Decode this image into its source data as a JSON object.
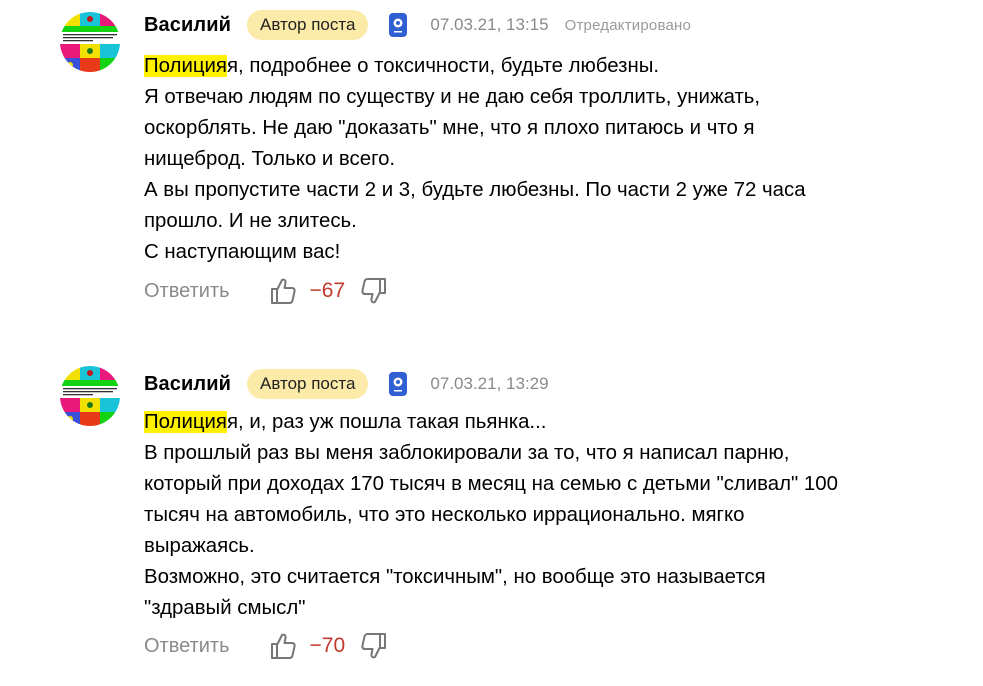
{
  "comments": [
    {
      "author": "Василий",
      "badge": "Автор поста",
      "date": "07.03.21, 13:15",
      "edited": "Отредактировано",
      "mention": "Полиция",
      "first_line_rest": "я, подробнее о токсичности, будьте любезны.",
      "lines": [
        "Я отвечаю людям по существу и не даю себя троллить, унижать,",
        "оскорблять. Не даю \"доказать\" мне, что я плохо питаюсь и что я",
        "нищеброд. Только и всего.",
        "А вы пропустите части 2 и 3, будьте любезны. По части 2 уже 72 часа",
        "прошло. И не злитесь.",
        "С наступающим вас!"
      ],
      "reply_label": "Ответить",
      "score": "−67"
    },
    {
      "author": "Василий",
      "badge": "Автор поста",
      "date": "07.03.21, 13:29",
      "mention": "Полиция",
      "first_line_rest": "я, и, раз уж пошла такая пьянка...",
      "lines": [
        "В прошлый раз вы меня заблокировали за то, что я написал парню,",
        "который при доходах 170 тысяч в месяц на семью с детьми \"сливал\" 100",
        "тысяч на автомобиль, что это несколько иррационально. мягко",
        "выражаясь.",
        "Возможно, это считается \"токсичным\", но вообще это называется",
        "\"здравый смысл\""
      ],
      "reply_label": "Ответить",
      "score": "−70"
    }
  ],
  "colors": {
    "badge_bg": "#fbeaa8",
    "mention_highlight": "#fff200",
    "score_negative": "#c0392b",
    "meta_gray": "#8a8a8a",
    "publisher_icon_blue": "#2f5fd0"
  },
  "icons": [
    "avatar-image",
    "publisher-icon",
    "thumbs-up-icon",
    "thumbs-down-icon"
  ]
}
